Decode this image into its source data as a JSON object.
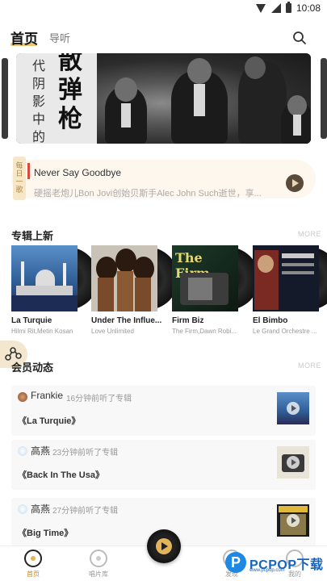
{
  "status_bar": {
    "time": "10:08"
  },
  "top_nav": {
    "tab_home": "首页",
    "tab_guide": "导听",
    "search_icon": "search-icon"
  },
  "banner": {
    "small_text": "代阴影中的",
    "big_text": "散弹枪",
    "image": "jazz-band-photo"
  },
  "now_playing": {
    "tab_text": "每日一歌",
    "title": "Never Say Goodbye",
    "description": "硬摇老炮儿Bon Jovi创始贝斯手Alec John Such逝世，享...",
    "play_icon": "play-icon"
  },
  "new_albums": {
    "title": "专辑上新",
    "more": "MORE",
    "items": [
      {
        "name": "La Turquie",
        "artist": "Hilmi Rit,Metin Kosan"
      },
      {
        "name": "Under The Influe...",
        "artist": "Love Unlimited"
      },
      {
        "name": "Firm Biz",
        "artist": "The Firm,Dawn Robi..."
      },
      {
        "name": "El Bimbo",
        "artist": "Le Grand Orchestre ..."
      }
    ]
  },
  "member_activity": {
    "title": "会员动态",
    "more": "MORE",
    "items": [
      {
        "user": "Frankie",
        "time": "16分钟前听了专辑",
        "album": "《La Turquie》"
      },
      {
        "user": "高燕",
        "time": "23分钟前听了专辑",
        "album": "《Back In The Usa》"
      },
      {
        "user": "高燕",
        "time": "27分钟前听了专辑",
        "album": "《Big Time》"
      }
    ]
  },
  "bottom_bar": {
    "items": [
      {
        "label": "首页",
        "icon": "home-disc-icon"
      },
      {
        "label": "唱片库",
        "icon": "record-library-icon"
      },
      {
        "label": "发现",
        "icon": "discover-icon"
      },
      {
        "label": "我的",
        "icon": "profile-icon"
      }
    ],
    "center_play_icon": "play-icon"
  },
  "watermark": {
    "text": "PCPOP下载",
    "sub": "www.pcpop.com"
  },
  "colors": {
    "accent": "#f0c36e",
    "card_bg": "#fdf7ee",
    "active_label": "#c58a2a"
  }
}
